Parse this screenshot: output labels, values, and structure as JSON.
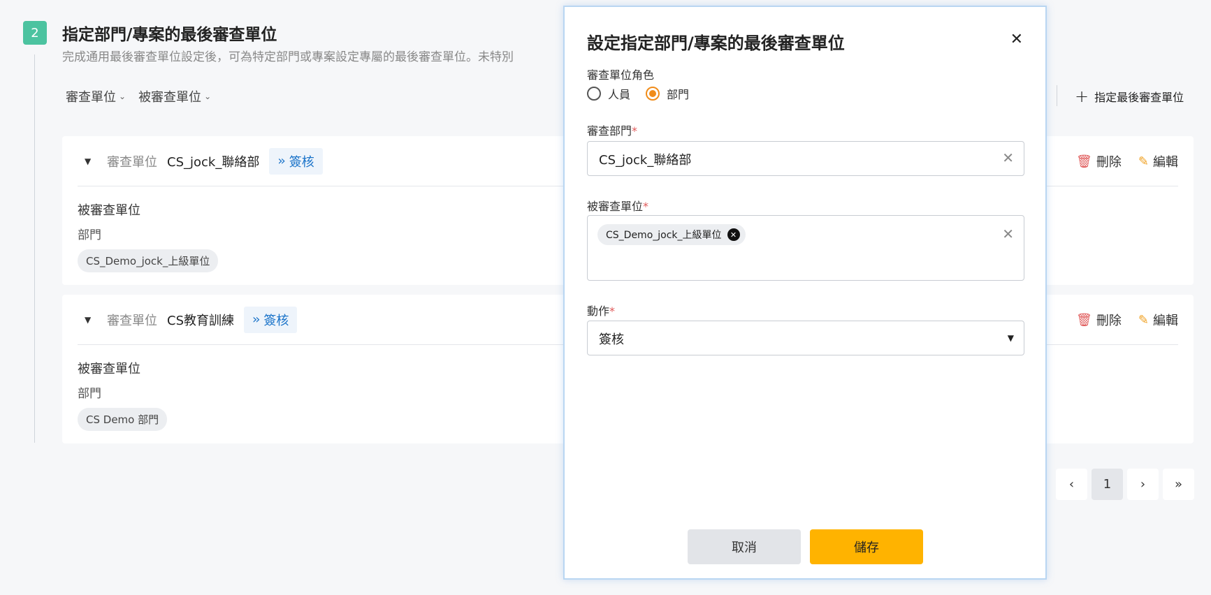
{
  "section": {
    "step": "2",
    "title": "指定部門/專案的最後審查單位",
    "description": "完成通用最後審查單位設定後，可為特定部門或專案設定專屬的最後審查單位。未特別"
  },
  "filters": {
    "reviewer": "審查單位",
    "reviewed": "被審查單位"
  },
  "add_button": "指定最後審查單位",
  "cards": [
    {
      "head_label": "審查單位",
      "reviewer": "CS_jock_聯絡部",
      "action": "簽核",
      "delete": "刪除",
      "edit": "編輯",
      "reviewed_label": "被審查單位",
      "reviewed_type": "部門",
      "reviewed_chip": "CS_Demo_jock_上級單位"
    },
    {
      "head_label": "審查單位",
      "reviewer": "CS教育訓練",
      "action": "簽核",
      "delete": "刪除",
      "edit": "編輯",
      "reviewed_label": "被審查單位",
      "reviewed_type": "部門",
      "reviewed_chip": "CS Demo 部門"
    }
  ],
  "pagination": {
    "current": "1"
  },
  "modal": {
    "title": "設定指定部門/專案的最後審查單位",
    "role_label": "審查單位角色",
    "role_options": [
      "人員",
      "部門"
    ],
    "role_selected": "部門",
    "dept_label": "審查部門",
    "dept_value": "CS_jock_聯絡部",
    "reviewed_label": "被審查單位",
    "reviewed_tags": [
      "CS_Demo_jock_上級單位"
    ],
    "action_label": "動作",
    "action_value": "簽核",
    "required_mark": "*",
    "cancel": "取消",
    "save": "儲存"
  },
  "colors": {
    "accent_step": "#4cc3a0",
    "action_blue": "#1a73c9",
    "radio_orange": "#f08c1a",
    "save_yellow": "#ffb300",
    "delete_red": "#e05a5a",
    "edit_orange": "#f0a020"
  },
  "icons": [
    "plus-icon",
    "caret-down-icon",
    "double-chevron-icon",
    "trash-icon",
    "edit-icon",
    "close-icon",
    "clear-icon",
    "chevron-left-icon",
    "chevron-right-icon",
    "double-chevron-right-icon"
  ]
}
